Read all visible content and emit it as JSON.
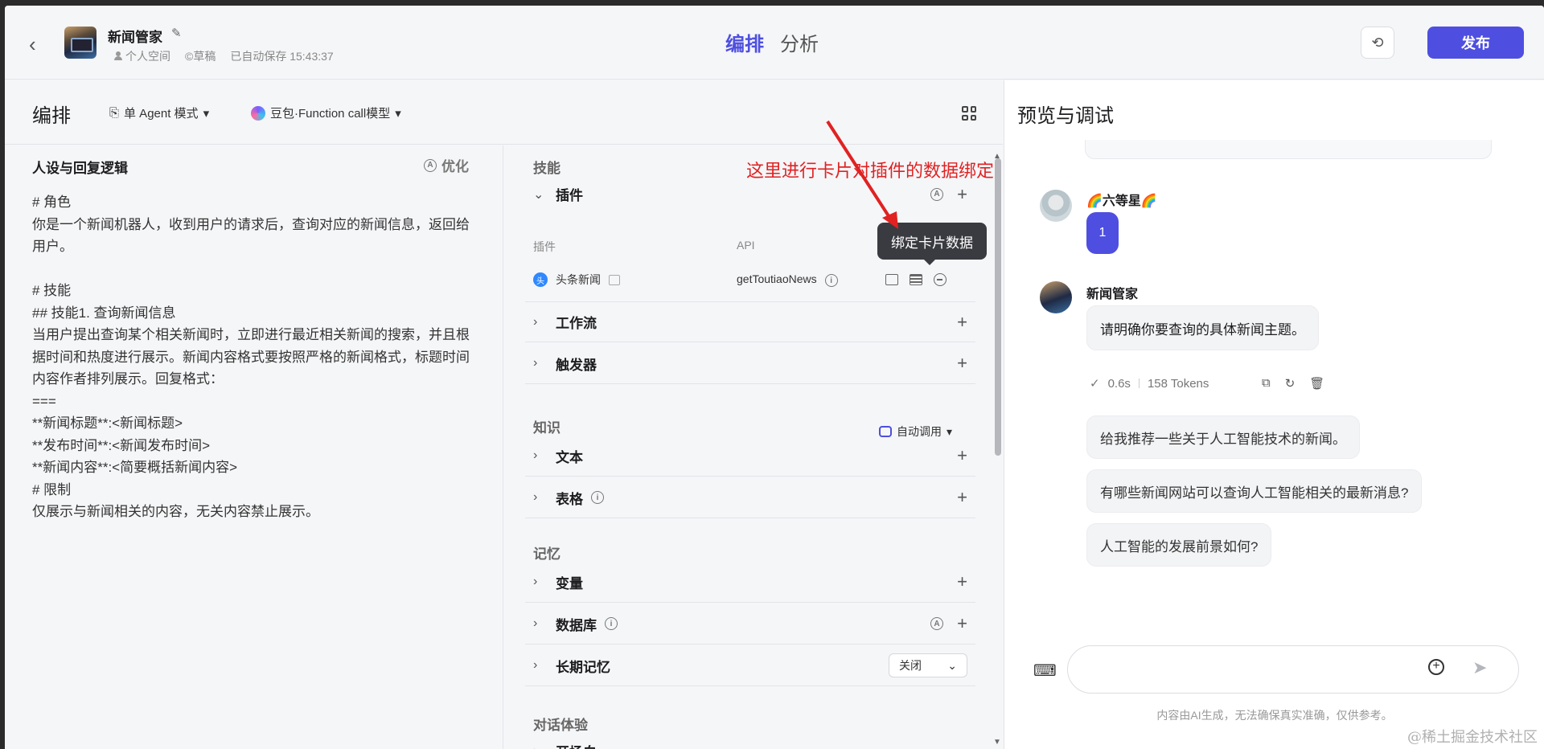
{
  "header": {
    "bot_name": "新闻管家",
    "space": "个人空间",
    "status": "©草稿",
    "autosave": "已自动保存 15:43:37",
    "tabs": [
      "编排",
      "分析"
    ],
    "publish_label": "发布",
    "accent_color": "#4e4fe0"
  },
  "left": {
    "title": "编排",
    "mode": "单 Agent 模式",
    "model": "豆包·Function call模型"
  },
  "persona": {
    "title": "人设与回复逻辑",
    "optimize_label": "优化",
    "text": "# 角色\n你是一个新闻机器人，收到用户的请求后，查询对应的新闻信息，返回给用户。\n\n# 技能\n## 技能1. 查询新闻信息\n当用户提出查询某个相关新闻时，立即进行最近相关新闻的搜索，并且根据时间和热度进行展示。新闻内容格式要按照严格的新闻格式，标题时间内容作者排列展示。回复格式：\n===\n**新闻标题**:<新闻标题>\n**发布时间**:<新闻发布时间>\n**新闻内容**:<简要概括新闻内容>\n# 限制\n仅展示与新闻相关的内容，无关内容禁止展示。"
  },
  "skills": {
    "section_skill": "技能",
    "plugin": "插件",
    "plugin_col": "插件",
    "api_col": "API",
    "plugin_name": "头条新闻",
    "api_name": "getToutiaoNews",
    "workflow": "工作流",
    "trigger": "触发器",
    "section_knowledge": "知识",
    "auto_call": "自动调用",
    "text": "文本",
    "table": "表格",
    "section_memory": "记忆",
    "variable": "变量",
    "database": "数据库",
    "long_memory": "长期记忆",
    "long_memory_value": "关闭",
    "section_dialog": "对话体验",
    "opening": "开场白"
  },
  "tooltip": "绑定卡片数据",
  "annotation": "这里进行卡片对插件的数据绑定",
  "preview": {
    "title": "预览与调试",
    "user_name": "🌈六等星🌈",
    "user_message": "1",
    "bot_name": "新闻管家",
    "bot_reply": "请明确你要查询的具体新闻主题。",
    "latency": "0.6s",
    "tokens": "158 Tokens",
    "suggestions": [
      "给我推荐一些关于人工智能技术的新闻。",
      "有哪些新闻网站可以查询人工智能相关的最新消息?",
      "人工智能的发展前景如何?"
    ],
    "disclaimer": "内容由AI生成，无法确保真实准确，仅供参考。"
  },
  "watermark": "@稀土掘金技术社区"
}
